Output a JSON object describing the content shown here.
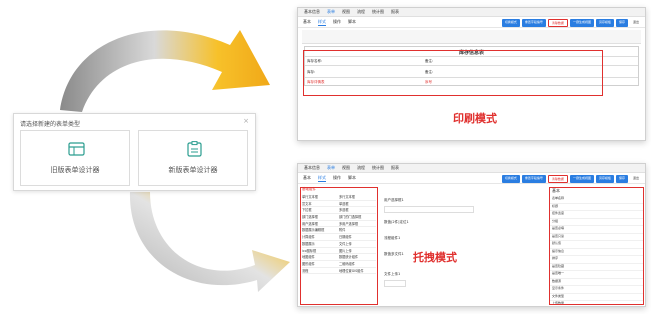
{
  "colors": {
    "accent": "#2a7de1",
    "highlight": "#e0302e",
    "arrow": "#f2b21a"
  },
  "dialog": {
    "title": "请选择新建的表单类型",
    "close": "×",
    "old_label": "旧版表单设计器",
    "new_label": "新版表单设计器",
    "old_icon": "table-form-icon",
    "new_icon": "clipboard-form-icon"
  },
  "menubar": [
    "基本信息",
    "表单",
    "视图",
    "流程",
    "统计图",
    "报表"
  ],
  "toolbar_tabs": [
    "基本",
    "样式",
    "操作",
    "脚本"
  ],
  "toolbar_buttons": [
    "切换模式",
    "重置字段编号",
    "清除数据",
    "一键生成视图",
    "另存模板",
    "保存",
    "退出"
  ],
  "print": {
    "mode_label": "印刷模式",
    "doc_title": "库存信息表",
    "rows": [
      {
        "left": "库存名称:",
        "right": "备注:"
      },
      {
        "left": "库存:",
        "right": "备注:"
      },
      {
        "left": "库存详情表",
        "right": "序号"
      }
    ]
  },
  "drag": {
    "mode_label": "托拽模式",
    "controls_title": "基础组件",
    "controls": [
      "单行文本框",
      "多行文本框",
      "富文本",
      "单选框",
      "下拉框",
      "多选框",
      "部门选择框",
      "部门的门选择框",
      "用户选择框",
      "多用户选择框",
      "数据展示编辑框",
      "附件",
      "计算组件",
      "日期组件",
      "数据展示",
      "文件上传",
      "ico图标框",
      "图片上传",
      "地图组件",
      "数据统计组件",
      "图形组件",
      "二维码组件",
      "流程",
      "地理位置GIS组件"
    ],
    "fields": [
      "用户选择框1",
      "数值(2件)定位1",
      "流程组件1",
      "数值多文件1",
      "文件上传1"
    ],
    "attr_title": "基本",
    "attr_rows": [
      "表单名称",
      "标题",
      "控件宽度",
      "分组",
      "是否必填",
      "是否只读",
      "默认值",
      "提示信息",
      "排序",
      "是否隐藏",
      "是否唯一",
      "数据源",
      "显示条件",
      "文件类型",
      "上传数量",
      "关联表单"
    ]
  }
}
